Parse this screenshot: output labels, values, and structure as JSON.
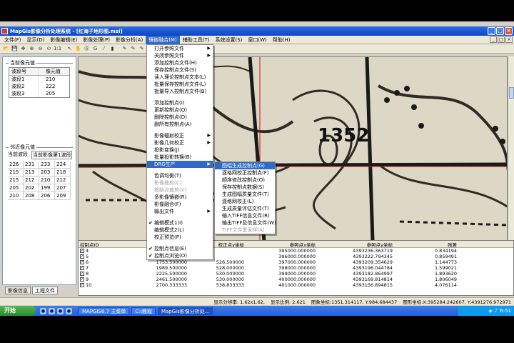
{
  "window": {
    "title": "MapGis影像分析处理系统 - [红海子地形图.msi]",
    "controls": [
      "_",
      "□",
      "×"
    ]
  },
  "menubar": [
    "文件(F)",
    "显示(D)",
    "影像编辑(E)",
    "影像处理(P)",
    "影像分析(A)",
    "镶嵌融合(M)",
    "辅助工具(T)",
    "系统设置(S)",
    "窗口(W)",
    "帮助(H)"
  ],
  "menubar_active_index": 5,
  "toolbar": {
    "icons": [
      "open-icon",
      "save-icon",
      "move-icon",
      "zoom-in-icon",
      "zoom-out-icon",
      "fit-icon",
      "one-to-one-icon",
      "pointer-icon",
      "pan-icon",
      "grid-icon",
      "color-icon",
      "line-icon",
      "histogram-icon",
      "pencil-icon",
      "pencil-icon",
      "pencil-icon",
      "rectangle-icon"
    ],
    "glyphs": [
      "📂",
      "💾",
      "✥",
      "⊕",
      "⊖",
      "⊙",
      "1:1",
      "↖",
      "✋",
      "Ⓖ",
      "G",
      "⁄",
      "▮",
      "✎",
      "✎",
      "✎",
      "□"
    ]
  },
  "left_panel": {
    "current_value_title": "当前像元值",
    "band_header": [
      "波段号",
      "像元值"
    ],
    "bands": [
      {
        "name": "波段1",
        "value": "210"
      },
      {
        "name": "波段2",
        "value": "222"
      },
      {
        "name": "波段3",
        "value": "205"
      }
    ],
    "neighbor_title": "邻近像元值",
    "neighbor_labels": [
      "当前波段",
      "当前影像第1波段"
    ],
    "neighbor_grid": [
      [
        "226",
        "231",
        "233",
        "224"
      ],
      [
        "215",
        "213",
        "203",
        "218"
      ],
      [
        "215",
        "212",
        "210",
        "212"
      ],
      [
        "205",
        "202",
        "199",
        "207"
      ],
      [
        "210",
        "208",
        "206",
        "209"
      ]
    ],
    "tabs": [
      "影像信息",
      "工程文件"
    ]
  },
  "mosaic_menu": [
    {
      "label": "打开参照文件",
      "submenu": true
    },
    {
      "label": "关闭参照文件",
      "submenu": true
    },
    {
      "label": "添加控制点文件(H)"
    },
    {
      "label": "保存控制点文件(S)"
    },
    {
      "label": "读入理论控制点文本(L)"
    },
    {
      "label": "批量保存控制点文件(L)"
    },
    {
      "label": "批量导入控制点文件(B)"
    },
    {
      "label": "添加控制点(I)",
      "sep": true
    },
    {
      "label": "更新控制点(Q)"
    },
    {
      "label": "删除控制点(D)"
    },
    {
      "label": "删所有控制点(A)"
    },
    {
      "label": "影像辐射校正",
      "submenu": true,
      "sep": true
    },
    {
      "label": "影像几何校正",
      "submenu": true
    },
    {
      "label": "投影变换(J)"
    },
    {
      "label": "批量投影转换(B)"
    },
    {
      "label": "DRG生产",
      "submenu": true,
      "highlight": true
    },
    {
      "label": "色调均衡(T)",
      "sep": true
    },
    {
      "label": "影像裁剪(C)",
      "disabled": true
    },
    {
      "label": "按结点裁剪(V)",
      "disabled": true
    },
    {
      "label": "多影像镶嵌(R)"
    },
    {
      "label": "影像融合(F)"
    },
    {
      "label": "输出文件",
      "submenu": true
    },
    {
      "label": "编辑模式1(I)",
      "sep": true,
      "checked": true
    },
    {
      "label": "编辑模式2(L)"
    },
    {
      "label": "校正预览(P)"
    },
    {
      "label": "控制点信息(E)",
      "sep": true,
      "checked": true
    },
    {
      "label": "控制点浏览(O)",
      "checked": true
    }
  ],
  "drg_submenu": [
    {
      "label": "图幅生成控制点(G)",
      "highlight": true
    },
    {
      "label": "逐格网校正控制点(F)"
    },
    {
      "label": "顺序修改控制点(O)"
    },
    {
      "label": "保存控制点数据(S)"
    },
    {
      "label": "生成图幅质量文件(T)"
    },
    {
      "label": "逐格网校正(L)"
    },
    {
      "label": "生成质量评估文件(T)"
    },
    {
      "label": "输入TIFF信息文件(R)"
    },
    {
      "label": "输出TIFF及信息文件(W)"
    },
    {
      "label": "TIFF文件重采样(A)",
      "disabled": true
    }
  ],
  "drg_tooltip": "图幅生成控制点",
  "map_labels": {
    "elevation": "1352"
  },
  "control_table": {
    "headers": [
      "控制点ID",
      "校正点x坐标",
      "校正点y坐标",
      "参照点x坐标",
      "参照点y坐标",
      "残差"
    ],
    "rows": [
      {
        "id": "4",
        "x": "125",
        "y": "",
        "rx": "395000.000000",
        "ry": "4393236.363719",
        "res": "0.834194"
      },
      {
        "id": "5",
        "x": "129",
        "y": "",
        "rx": "396000.000000",
        "ry": "4393222.794345",
        "res": "0.859491"
      },
      {
        "id": "6",
        "x": "1753.500000",
        "y": "526.500000",
        "rx": "397000.000000",
        "ry": "4393209.354629",
        "res": "1.144773"
      },
      {
        "id": "7",
        "x": "1989.500000",
        "y": "528.000000",
        "rx": "398000.000000",
        "ry": "4393196.044784",
        "res": "1.599021"
      },
      {
        "id": "8",
        "x": "2225.500000",
        "y": "530.000000",
        "rx": "399000.000000",
        "ry": "4393182.864997",
        "res": "1.893620"
      },
      {
        "id": "9",
        "x": "2461.500000",
        "y": "530.000000",
        "rx": "400000.000000",
        "ry": "4393169.814814",
        "res": "1.806049"
      },
      {
        "id": "10",
        "x": "2700.333333",
        "y": "538.833333",
        "rx": "401000.000000",
        "ry": "4393156.894815",
        "res": "4.076114"
      }
    ]
  },
  "status": {
    "resolution": "显示分辨率: 1.62x1.62,",
    "scale": "显示比例: 2.621",
    "image_coord": "图象坐标:1351.314117, Y:984.684437",
    "map_coord": "图形坐标:X:395284.242607, Y:4391276.972971"
  },
  "taskbar": {
    "start": "开始",
    "quick_icons": [
      "ie-icon",
      "media-icon",
      "desktop-icon",
      "explorer-icon"
    ],
    "tasks": [
      {
        "label": "MAPGIS6.7 主菜单",
        "active": false
      },
      {
        "label": "C:\\教程",
        "active": false
      },
      {
        "label": "MapGis影像分析处...",
        "active": true
      }
    ],
    "clock": "6:51"
  }
}
